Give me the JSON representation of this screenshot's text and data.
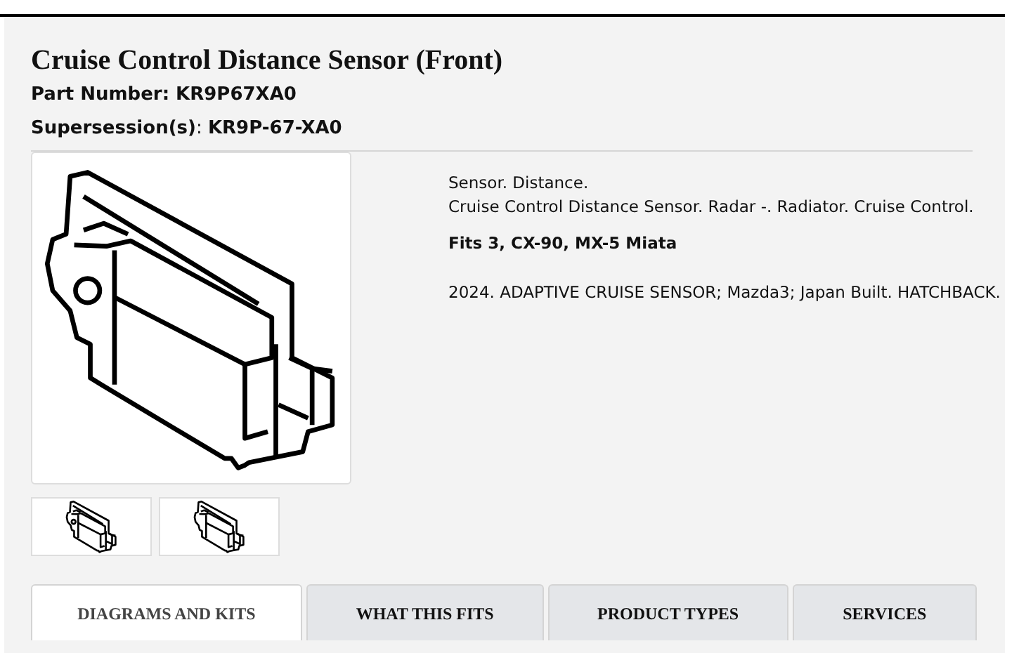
{
  "title": "Cruise Control Distance Sensor (Front)",
  "part_number": "Part Number: KR9P67XA0",
  "supersession": "**Supersession(s)**: **KR9P-67-XA0**",
  "thumbnails": [
    {
      "kind": "front",
      "selected": false
    },
    {
      "kind": "back",
      "selected": false
    }
  ],
  "description": [
    "Sensor. Distance.",
    "Cruise Control Distance Sensor. Radar -. Radiator. Cruise Control."
  ],
  "fits": "Fits 3, CX-90, MX-5 Miata",
  "notes": "2024. ADAPTIVE CRUISE SENSOR; Mazda3; Japan Built. HATCHBACK.",
  "tabs": [
    {
      "label": "DIAGRAMS AND KITS",
      "selected": true
    },
    {
      "label": "WHAT THIS FITS",
      "selected": false
    },
    {
      "label": "PRODUCT TYPES",
      "selected": false
    },
    {
      "label": "SERVICES",
      "selected": false
    }
  ]
}
